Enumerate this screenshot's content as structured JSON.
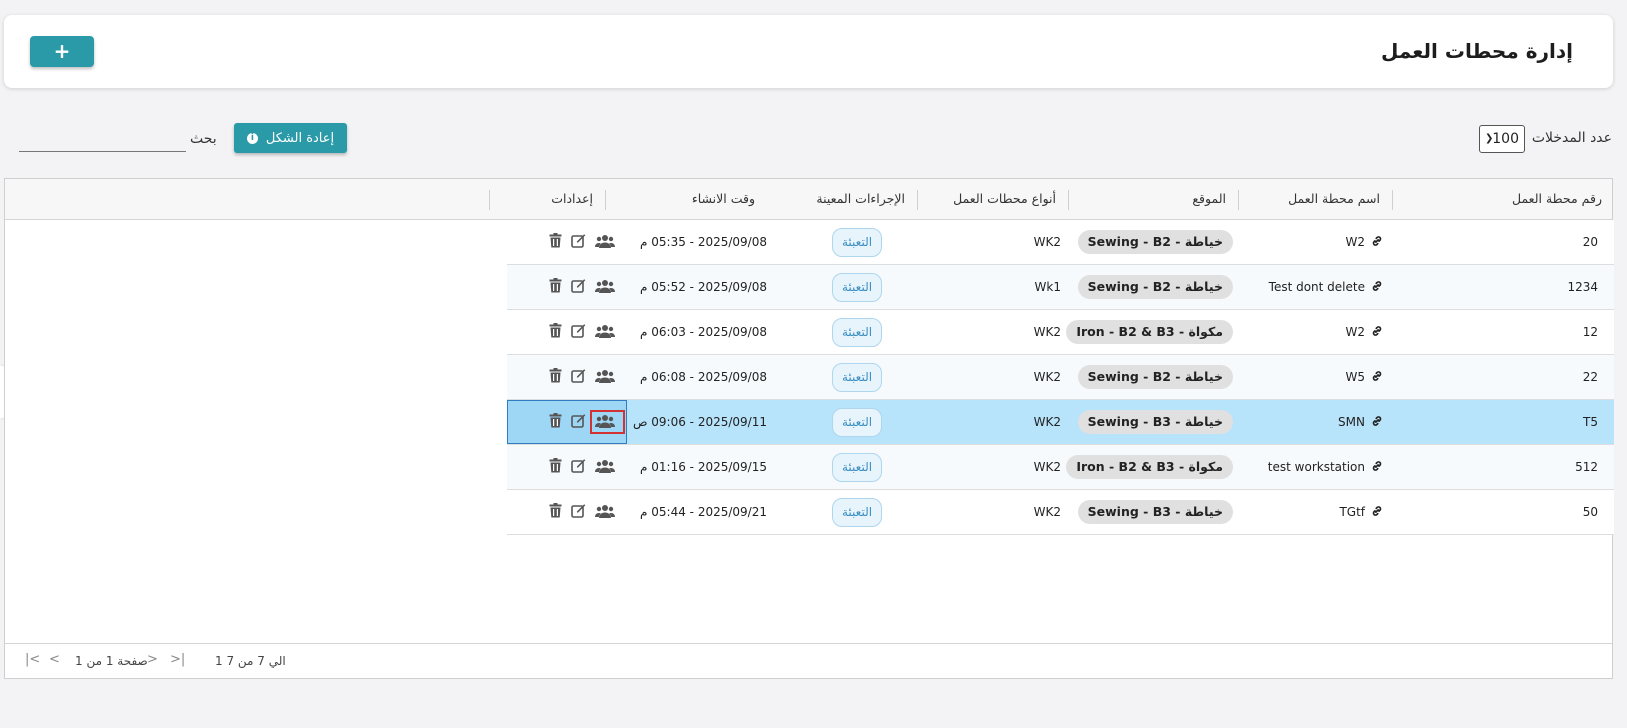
{
  "header": {
    "title": "إدارة محطات العمل",
    "add_label": "+"
  },
  "toolbar": {
    "entries_label": "عدد المدخلات",
    "entries_value": "100",
    "reset_label": "إعادة الشكل",
    "search_label": "بحث",
    "search_value": ""
  },
  "table": {
    "columns": [
      "رقم محطة العمل",
      "اسم محطة العمل",
      "الموقع",
      "أنواع محطات العمل",
      "الإجراءات المعينة",
      "وقت الانشاء",
      "إعدادات"
    ],
    "rows": [
      {
        "number": "20",
        "name": "W2",
        "location": "Sewing - B2 - خياطة",
        "type": "WK2",
        "procedure": "التعبئة",
        "created": "2025/09/08 - 05:35 م"
      },
      {
        "number": "1234",
        "name": "Test dont delete",
        "location": "Sewing - B2 - خياطة",
        "type": "Wk1",
        "procedure": "التعبئة",
        "created": "2025/09/08 - 05:52 م"
      },
      {
        "number": "12",
        "name": "W2",
        "location": "Iron - B2 & B3 - مكواة",
        "type": "WK2",
        "procedure": "التعبئة",
        "created": "2025/09/08 - 06:03 م"
      },
      {
        "number": "22",
        "name": "W5",
        "location": "Sewing - B2 - خياطة",
        "type": "WK2",
        "procedure": "التعبئة",
        "created": "2025/09/08 - 06:08 م"
      },
      {
        "number": "T5",
        "name": "SMN",
        "location": "Sewing - B3 - خياطة",
        "type": "WK2",
        "procedure": "التعبئة",
        "created": "2025/09/11 - 09:06 ص"
      },
      {
        "number": "512",
        "name": "test workstation",
        "location": "Iron - B2 & B3 - مكواة",
        "type": "WK2",
        "procedure": "التعبئة",
        "created": "2025/09/15 - 01:16 م"
      },
      {
        "number": "50",
        "name": "TGtf",
        "location": "Sewing - B3 - خياطة",
        "type": "WK2",
        "procedure": "التعبئة",
        "created": "2025/09/21 - 05:44 م"
      }
    ],
    "selected_row": 4
  },
  "pagination": {
    "count_text": "1 الي 7 من 7",
    "page_text": "صفحة 1 من 1",
    "first": "|<",
    "prev": "<",
    "next": ">",
    "last": ">|"
  },
  "colors": {
    "accent": "#2a9aa8",
    "selected_row": "#b7e3fb",
    "badge_bg": "#e0e0e0",
    "procedure_text": "#3b8ec2"
  }
}
